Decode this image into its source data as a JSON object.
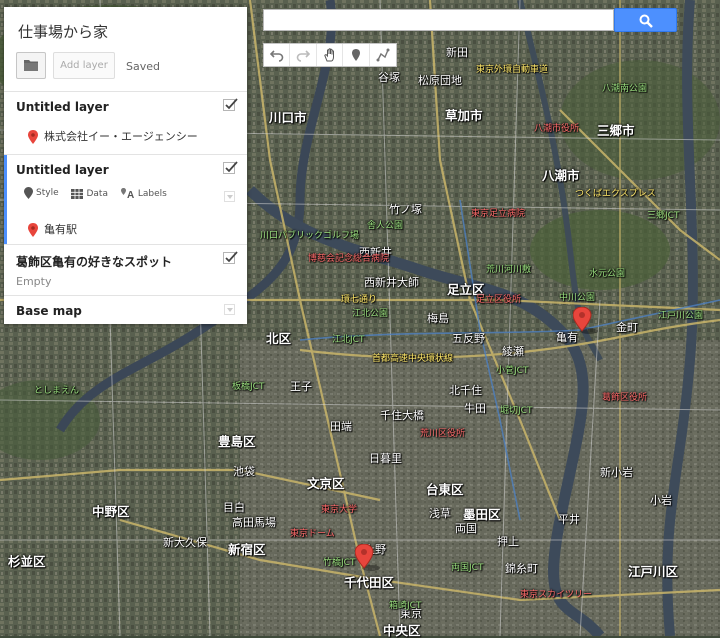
{
  "panel": {
    "map_title": "仕事場から家",
    "add_layer_label": "Add layer",
    "saved_label": "Saved"
  },
  "layers": [
    {
      "name": "Untitled layer",
      "checked": true,
      "items": [
        "株式会社イー・エージェンシー"
      ]
    },
    {
      "name": "Untitled layer",
      "checked": true,
      "tools": {
        "style": "Style",
        "data": "Data",
        "labels": "Labels"
      },
      "items": [
        "亀有駅"
      ]
    },
    {
      "name": "葛飾区亀有の好きなスポット",
      "checked": true,
      "empty_label": "Empty"
    },
    {
      "name": "Base map"
    }
  ],
  "search": {
    "value": "",
    "button_icon": "search-icon"
  },
  "toolbar": {
    "icons": [
      "undo-icon",
      "redo-icon",
      "hand-icon",
      "marker-icon",
      "line-icon"
    ]
  },
  "colors": {
    "accent": "#4d90fe",
    "pin": "#e8453c",
    "panel_bg": "#ffffff"
  },
  "map_labels": [
    {
      "text": "川口市",
      "cls": "big"
    },
    {
      "text": "草加市",
      "cls": "big"
    },
    {
      "text": "三郷市",
      "cls": "big"
    },
    {
      "text": "八潮市",
      "cls": "big"
    },
    {
      "text": "足立区",
      "cls": "big"
    },
    {
      "text": "北区",
      "cls": "big"
    },
    {
      "text": "豊島区",
      "cls": "big"
    },
    {
      "text": "文京区",
      "cls": "big"
    },
    {
      "text": "台東区",
      "cls": "big"
    },
    {
      "text": "墨田区",
      "cls": "big"
    },
    {
      "text": "中野区",
      "cls": "big"
    },
    {
      "text": "新宿区",
      "cls": "big"
    },
    {
      "text": "千代田区",
      "cls": "big"
    },
    {
      "text": "江戸川区",
      "cls": "big"
    },
    {
      "text": "杉並区",
      "cls": "big"
    },
    {
      "text": "中央区",
      "cls": "big"
    },
    {
      "text": "亀有",
      "cls": ""
    },
    {
      "text": "金町",
      "cls": ""
    },
    {
      "text": "綾瀬",
      "cls": ""
    },
    {
      "text": "北千住",
      "cls": ""
    },
    {
      "text": "千住大橋",
      "cls": ""
    },
    {
      "text": "牛田",
      "cls": ""
    },
    {
      "text": "梅島",
      "cls": ""
    },
    {
      "text": "五反野",
      "cls": ""
    },
    {
      "text": "西新井大師",
      "cls": ""
    },
    {
      "text": "王子",
      "cls": ""
    },
    {
      "text": "田端",
      "cls": ""
    },
    {
      "text": "日暮里",
      "cls": ""
    },
    {
      "text": "上野",
      "cls": ""
    },
    {
      "text": "浅草",
      "cls": ""
    },
    {
      "text": "押上",
      "cls": ""
    },
    {
      "text": "錦糸町",
      "cls": ""
    },
    {
      "text": "池袋",
      "cls": ""
    },
    {
      "text": "目白",
      "cls": ""
    },
    {
      "text": "高田馬場",
      "cls": ""
    },
    {
      "text": "新大久保",
      "cls": ""
    },
    {
      "text": "東京",
      "cls": ""
    },
    {
      "text": "両国",
      "cls": ""
    },
    {
      "text": "平井",
      "cls": ""
    },
    {
      "text": "小岩",
      "cls": ""
    },
    {
      "text": "新小岩",
      "cls": ""
    },
    {
      "text": "松原団地",
      "cls": ""
    },
    {
      "text": "新田",
      "cls": ""
    },
    {
      "text": "谷塚",
      "cls": ""
    },
    {
      "text": "竹ノ塚",
      "cls": ""
    },
    {
      "text": "西新井",
      "cls": ""
    },
    {
      "text": "江北JCT",
      "cls": "g"
    },
    {
      "text": "小菅JCT",
      "cls": "g"
    },
    {
      "text": "堀切JCT",
      "cls": "g"
    },
    {
      "text": "三郷JCT",
      "cls": "g"
    },
    {
      "text": "板橋JCT",
      "cls": "g"
    },
    {
      "text": "両国JCT",
      "cls": "g"
    },
    {
      "text": "箱崎JCT",
      "cls": "g"
    },
    {
      "text": "竹橋JCT",
      "cls": "g"
    },
    {
      "text": "江戸川公園",
      "cls": "g"
    },
    {
      "text": "中川公園",
      "cls": "g"
    },
    {
      "text": "水元公園",
      "cls": "g"
    },
    {
      "text": "としまえん",
      "cls": "g"
    },
    {
      "text": "八潮南公園",
      "cls": "g"
    },
    {
      "text": "荒川河川敷",
      "cls": "g"
    },
    {
      "text": "川口パブリックゴルフ場",
      "cls": "g"
    },
    {
      "text": "舎人公園",
      "cls": "g"
    },
    {
      "text": "江北公園",
      "cls": "g"
    },
    {
      "text": "博慈会記念総合病院",
      "cls": "r"
    },
    {
      "text": "東京足立病院",
      "cls": "r"
    },
    {
      "text": "八潮市役所",
      "cls": "r"
    },
    {
      "text": "足立区役所",
      "cls": "r"
    },
    {
      "text": "荒川区役所",
      "cls": "r"
    },
    {
      "text": "葛飾区役所",
      "cls": "r"
    },
    {
      "text": "東京スカイツリー",
      "cls": "r"
    },
    {
      "text": "東京大学",
      "cls": "r"
    },
    {
      "text": "東京ドーム",
      "cls": "r"
    },
    {
      "text": "首都高速中央環状線",
      "cls": "y"
    },
    {
      "text": "つくばエクスプレス",
      "cls": "y"
    },
    {
      "text": "環七通り",
      "cls": "y"
    },
    {
      "text": "東京外環自動車道",
      "cls": "y"
    }
  ]
}
